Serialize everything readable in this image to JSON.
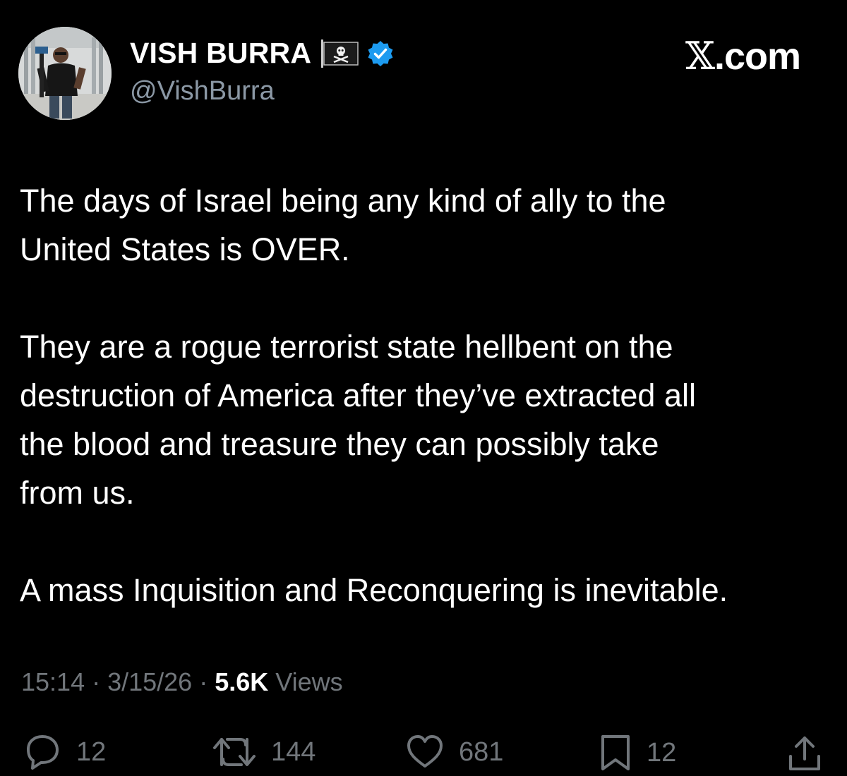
{
  "author": {
    "display_name": "VISH BURRA",
    "handle": "@VishBurra",
    "flag_icon": "pirate-flag-icon",
    "verified_icon": "verified-badge-icon",
    "verified_color": "#1d9bf0"
  },
  "site": {
    "logo_glyph": "𝕏",
    "logo_text": ".com"
  },
  "tweet": {
    "paragraphs": [
      "The days of Israel being any kind of ally to the\nUnited States is OVER.",
      "They are a rogue terrorist state hellbent on the\ndestruction of America after they’ve extracted all\nthe blood and treasure they can possibly take\nfrom us.",
      "A mass Inquisition and Reconquering is inevitable."
    ]
  },
  "meta": {
    "time": "15:14",
    "separator": " · ",
    "date": "3/15/26",
    "views_count": "5.6K",
    "views_label": " Views"
  },
  "actions": {
    "replies": {
      "icon": "reply-icon",
      "count": "12"
    },
    "reposts": {
      "icon": "repost-icon",
      "count": "144"
    },
    "likes": {
      "icon": "heart-icon",
      "count": "681"
    },
    "bookmarks": {
      "icon": "bookmark-icon",
      "count": "12"
    },
    "share": {
      "icon": "share-icon"
    }
  },
  "colors": {
    "background": "#000000",
    "text_primary": "#ffffff",
    "text_secondary": "#71767b"
  }
}
